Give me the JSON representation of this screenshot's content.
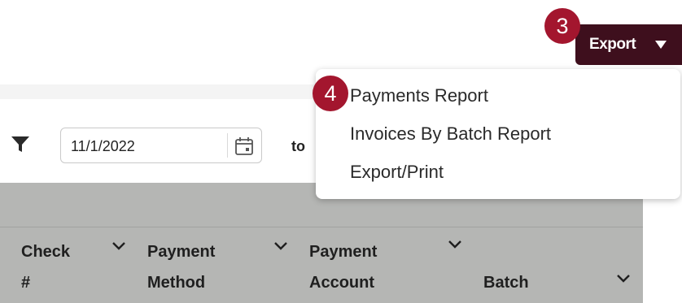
{
  "toolbar": {
    "export_label": "Export"
  },
  "steps": {
    "export_step": "3",
    "menu_step": "4"
  },
  "export_menu": {
    "items": [
      {
        "label": "Payments Report"
      },
      {
        "label": "Invoices By Batch Report"
      },
      {
        "label": "Export/Print"
      }
    ]
  },
  "filters": {
    "date_from": "11/1/2022",
    "to_label": "to"
  },
  "table": {
    "columns": [
      {
        "label": "Check\n#"
      },
      {
        "label": "Payment\nMethod"
      },
      {
        "label": "Payment\nAccount"
      },
      {
        "label": "Batch"
      }
    ]
  },
  "icons": {
    "filter": "filter-icon",
    "calendar": "calendar-icon",
    "caret": "caret-down-icon",
    "chevron": "chevron-down-icon"
  },
  "colors": {
    "brand_dark": "#3e0f1d",
    "badge": "#a3162e",
    "header_bg": "#b5b6b4"
  }
}
